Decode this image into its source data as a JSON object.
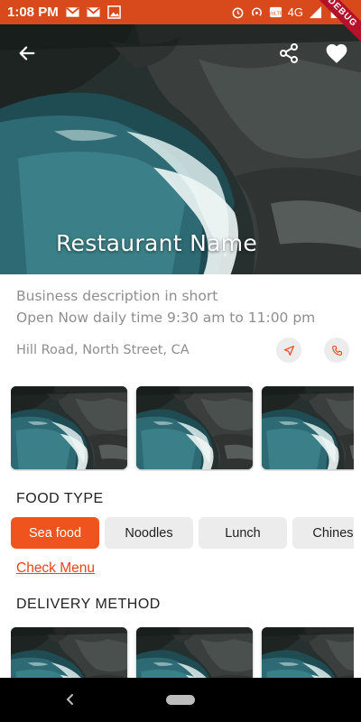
{
  "status_bar": {
    "time": "1:08 PM",
    "left_icons": [
      "gmail-icon",
      "gmail-icon",
      "image-icon"
    ],
    "network": "4G",
    "right_icons": [
      "alarm-icon",
      "hotspot-icon",
      "volte-icon",
      "signal-icon",
      "battery-icon"
    ],
    "ribbon": "DEBUG",
    "color": "#d8491c"
  },
  "header": {
    "back_icon": "arrow-left-icon",
    "share_icon": "share-icon",
    "favorite_icon": "heart-icon",
    "title": "Restaurant Name"
  },
  "info": {
    "description": "Business description in short",
    "hours": "Open Now daily time 9:30 am to 11:00 pm",
    "address": "Hill Road, North Street, CA",
    "navigate_icon": "navigation-arrow-icon",
    "call_icon": "phone-icon"
  },
  "gallery": {
    "image_count_visible": 3
  },
  "food_type": {
    "title": "FOOD TYPE",
    "items": [
      {
        "label": "Sea food",
        "selected": true
      },
      {
        "label": "Noodles",
        "selected": false
      },
      {
        "label": "Lunch",
        "selected": false
      },
      {
        "label": "Chinese",
        "selected": false
      }
    ],
    "accent": "#f0541e"
  },
  "check_menu": "Check Menu",
  "delivery": {
    "title": "DELIVERY METHOD"
  },
  "colors": {
    "accent": "#e8431a",
    "chip_bg": "#ececec",
    "muted_text": "#8e8e8e"
  }
}
